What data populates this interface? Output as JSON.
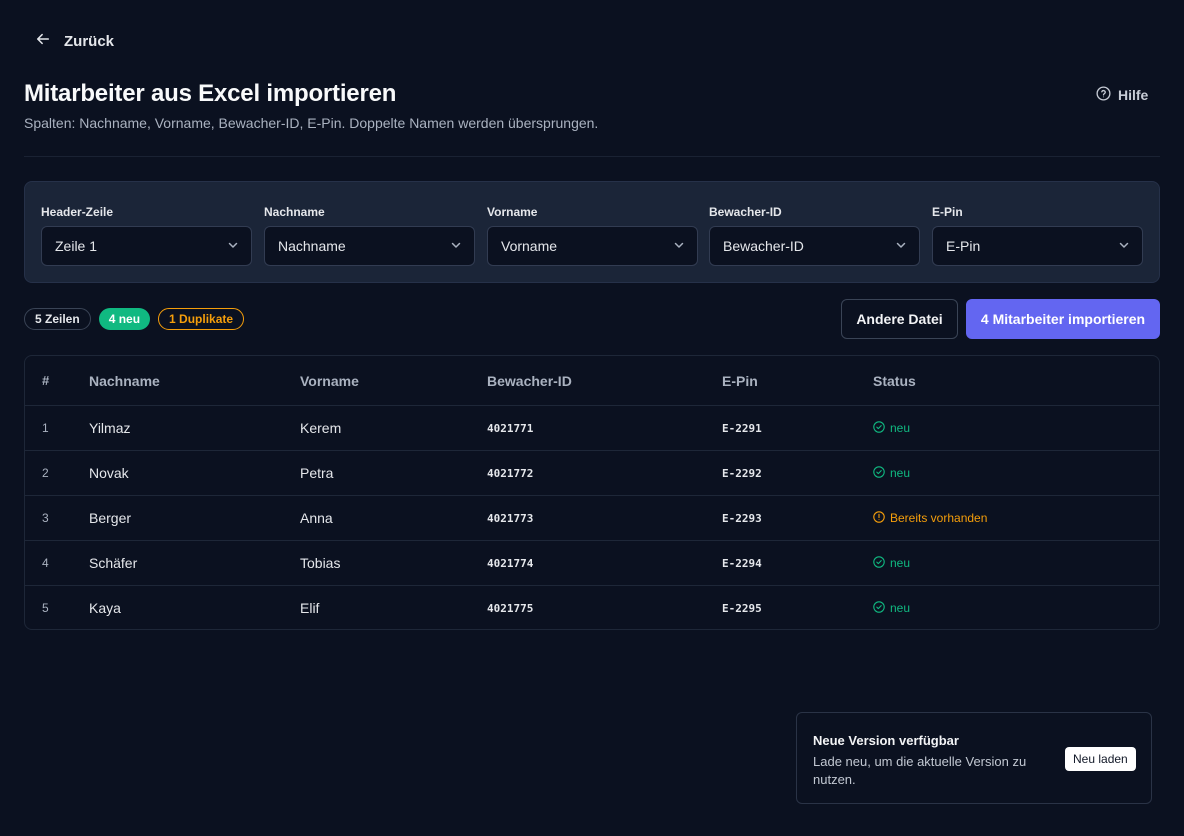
{
  "nav": {
    "back_label": "Zurück"
  },
  "header": {
    "title": "Mitarbeiter aus Excel importieren",
    "subtitle": "Spalten: Nachname, Vorname, Bewacher-ID, E-Pin. Doppelte Namen werden übersprungen.",
    "help_label": "Hilfe"
  },
  "mapping": {
    "fields": [
      {
        "label": "Header-Zeile",
        "value": "Zeile 1"
      },
      {
        "label": "Nachname",
        "value": "Nachname"
      },
      {
        "label": "Vorname",
        "value": "Vorname"
      },
      {
        "label": "Bewacher-ID",
        "value": "Bewacher-ID"
      },
      {
        "label": "E-Pin",
        "value": "E-Pin"
      }
    ]
  },
  "summary": {
    "rows_badge": "5 Zeilen",
    "new_badge": "4 neu",
    "duplicates_badge": "1 Duplikate"
  },
  "actions": {
    "other_file_label": "Andere Datei",
    "import_label": "4 Mitarbeiter importieren"
  },
  "table": {
    "columns": [
      "#",
      "Nachname",
      "Vorname",
      "Bewacher-ID",
      "E-Pin",
      "Status"
    ],
    "rows": [
      {
        "idx": "1",
        "last": "Yilmaz",
        "first": "Kerem",
        "id": "4021771",
        "pin": "E-2291",
        "status": "neu",
        "kind": "new"
      },
      {
        "idx": "2",
        "last": "Novak",
        "first": "Petra",
        "id": "4021772",
        "pin": "E-2292",
        "status": "neu",
        "kind": "new"
      },
      {
        "idx": "3",
        "last": "Berger",
        "first": "Anna",
        "id": "4021773",
        "pin": "E-2293",
        "status": "Bereits vorhanden",
        "kind": "dup"
      },
      {
        "idx": "4",
        "last": "Schäfer",
        "first": "Tobias",
        "id": "4021774",
        "pin": "E-2294",
        "status": "neu",
        "kind": "new"
      },
      {
        "idx": "5",
        "last": "Kaya",
        "first": "Elif",
        "id": "4021775",
        "pin": "E-2295",
        "status": "neu",
        "kind": "new"
      }
    ]
  },
  "toast": {
    "title": "Neue Version verfügbar",
    "message": "Lade neu, um die aktuelle Version zu nutzen.",
    "button_label": "Neu laden"
  },
  "icons": {
    "back": "arrow-left-icon",
    "help": "help-circle-icon",
    "select": "chevron-down-icon",
    "status_new": "check-circle-icon",
    "status_dup": "alert-circle-icon"
  },
  "colors": {
    "background": "#0b1120",
    "panel": "#1b2538",
    "accent": "#6366f1",
    "success": "#10b981",
    "warning": "#f59e0b"
  }
}
